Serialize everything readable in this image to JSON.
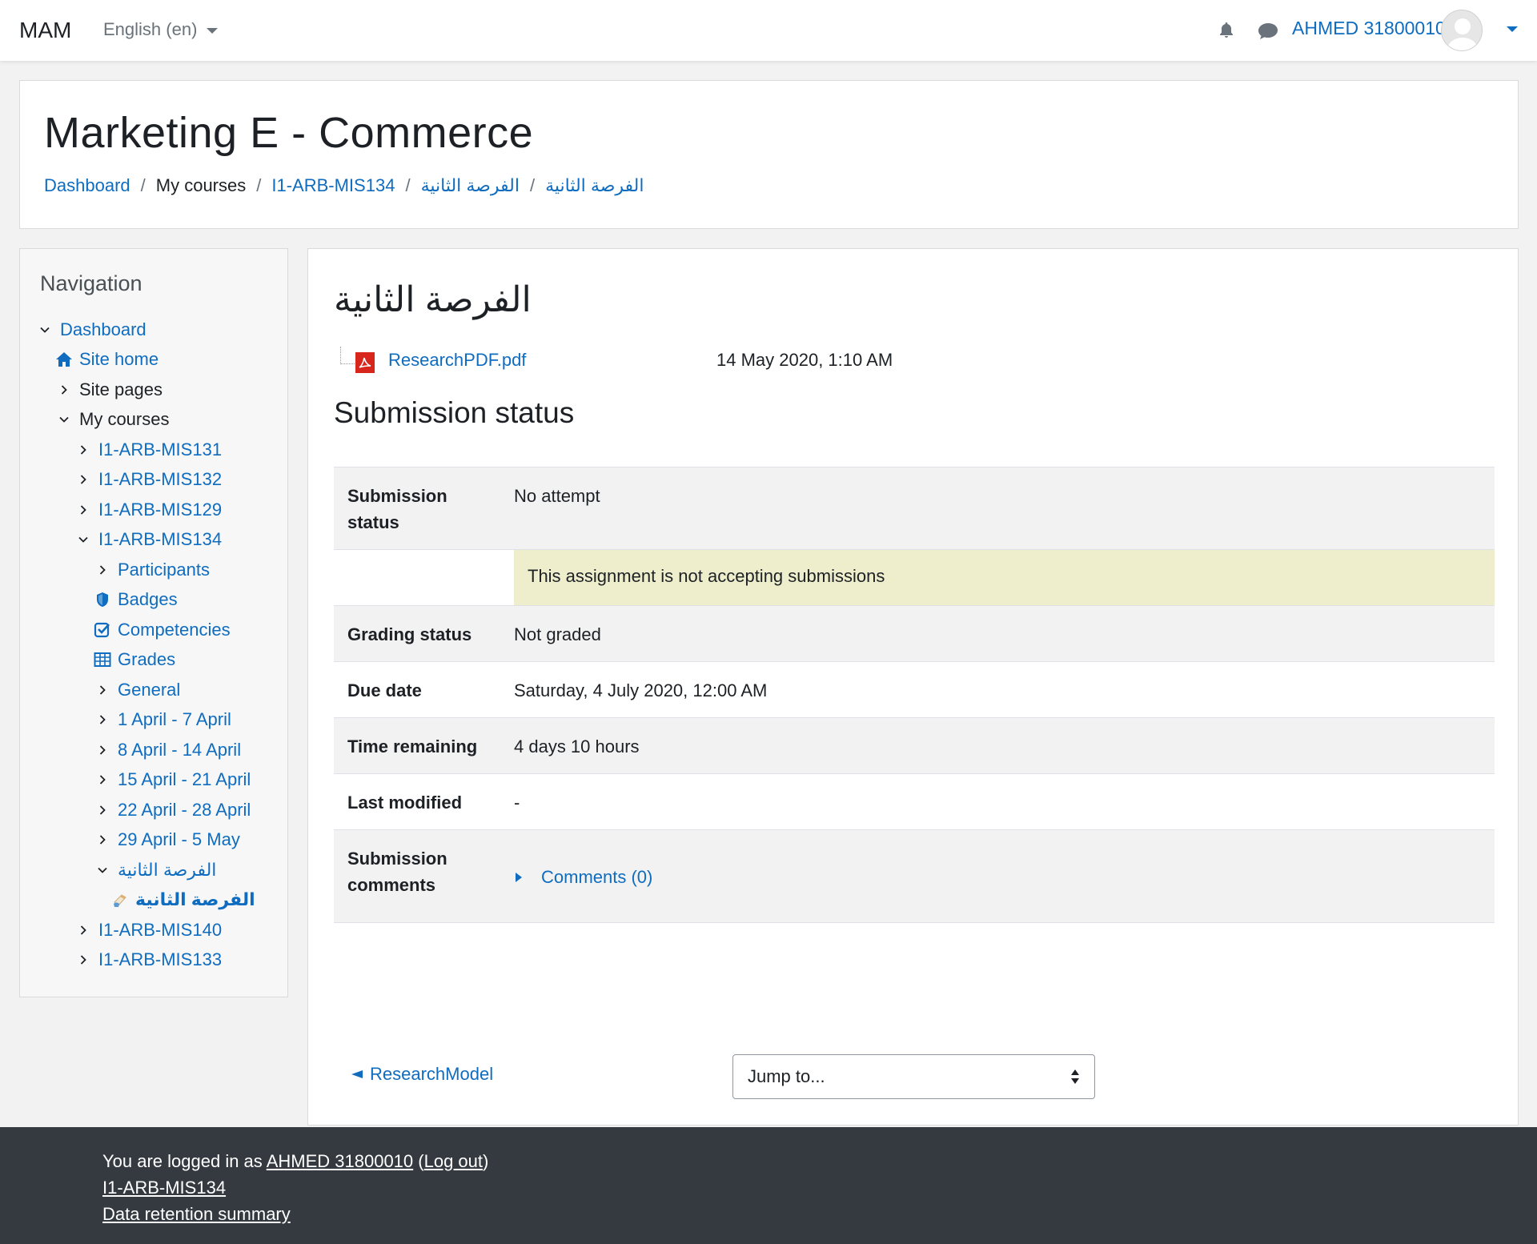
{
  "navbar": {
    "brand": "MAM",
    "language": "English (en)",
    "username": "AHMED 31800010"
  },
  "header": {
    "title": "Marketing E - Commerce",
    "breadcrumb": [
      "Dashboard",
      "My courses",
      "I1-ARB-MIS134",
      "الفرصة الثانية",
      "الفرصة الثانية"
    ]
  },
  "navigation": {
    "title": "Navigation",
    "items": [
      {
        "label": "Dashboard"
      },
      {
        "label": "Site home"
      },
      {
        "label": "Site pages"
      },
      {
        "label": "My courses"
      },
      {
        "label": "I1-ARB-MIS131"
      },
      {
        "label": "I1-ARB-MIS132"
      },
      {
        "label": "I1-ARB-MIS129"
      },
      {
        "label": "I1-ARB-MIS134"
      },
      {
        "label": "Participants"
      },
      {
        "label": "Badges"
      },
      {
        "label": "Competencies"
      },
      {
        "label": "Grades"
      },
      {
        "label": "General"
      },
      {
        "label": "1 April - 7 April"
      },
      {
        "label": "8 April - 14 April"
      },
      {
        "label": "15 April - 21 April"
      },
      {
        "label": "22 April - 28 April"
      },
      {
        "label": "29 April - 5 May"
      },
      {
        "label": "الفرصة الثانية"
      },
      {
        "label": "الفرصة الثانية"
      },
      {
        "label": "I1-ARB-MIS140"
      },
      {
        "label": "I1-ARB-MIS133"
      }
    ]
  },
  "main": {
    "title": "الفرصة الثانية",
    "file": {
      "name": "ResearchPDF.pdf",
      "date": "14 May 2020, 1:10 AM"
    },
    "section_heading": "Submission status",
    "table": {
      "submission_status_label": "Submission status",
      "submission_status_value": "No attempt",
      "notice": "This assignment is not accepting submissions",
      "grading_status_label": "Grading status",
      "grading_status_value": "Not graded",
      "due_date_label": "Due date",
      "due_date_value": "Saturday, 4 July 2020, 12:00 AM",
      "time_remaining_label": "Time remaining",
      "time_remaining_value": "4 days 10 hours",
      "last_modified_label": "Last modified",
      "last_modified_value": "-",
      "comments_label": "Submission comments",
      "comments_value": "Comments (0)"
    },
    "prev_activity": "ResearchModel",
    "jump_to": "Jump to..."
  },
  "footer": {
    "logged_in_prefix": "You are logged in as",
    "username": "AHMED 31800010",
    "logout": "Log out",
    "course_link": "I1-ARB-MIS134",
    "data_retention": "Data retention summary"
  },
  "colors": {
    "link": "#0f6cbf",
    "notice_bg": "#eeeecc",
    "footer_bg": "#343a40"
  }
}
